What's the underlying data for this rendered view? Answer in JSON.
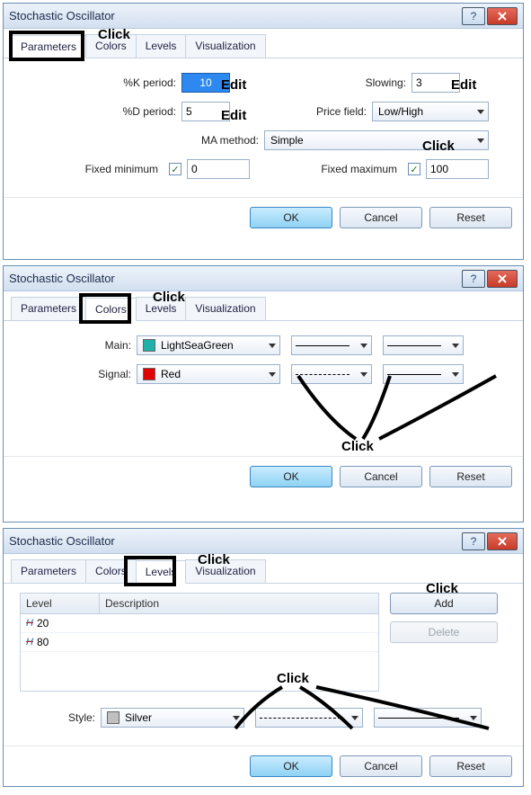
{
  "annot": {
    "click": "Click",
    "edit": "Edit"
  },
  "common": {
    "title": "Stochastic Oscillator",
    "tabs": {
      "parameters": "Parameters",
      "colors": "Colors",
      "levels": "Levels",
      "visualization": "Visualization"
    },
    "buttons": {
      "ok": "OK",
      "cancel": "Cancel",
      "reset": "Reset"
    }
  },
  "d1": {
    "labels": {
      "k_period": "%K period:",
      "d_period": "%D period:",
      "slowing": "Slowing:",
      "price_field": "Price field:",
      "ma_method": "MA method:",
      "fixed_min": "Fixed minimum",
      "fixed_max": "Fixed maximum"
    },
    "values": {
      "k_period": "10",
      "d_period": "5",
      "slowing": "3",
      "price_field": "Low/High",
      "ma_method": "Simple",
      "fixed_min": "0",
      "fixed_max": "100"
    }
  },
  "d2": {
    "labels": {
      "main": "Main:",
      "signal": "Signal:"
    },
    "values": {
      "main_color_name": "LightSeaGreen",
      "main_color_hex": "#20B2AA",
      "signal_color_name": "Red",
      "signal_color_hex": "#E00000"
    }
  },
  "d3": {
    "labels": {
      "level": "Level",
      "description": "Description",
      "style": "Style:",
      "add": "Add",
      "delete": "Delete"
    },
    "levels": [
      {
        "value": "20",
        "description": ""
      },
      {
        "value": "80",
        "description": ""
      }
    ],
    "style": {
      "color_name": "Silver",
      "color_hex": "#C0C0C0"
    }
  }
}
